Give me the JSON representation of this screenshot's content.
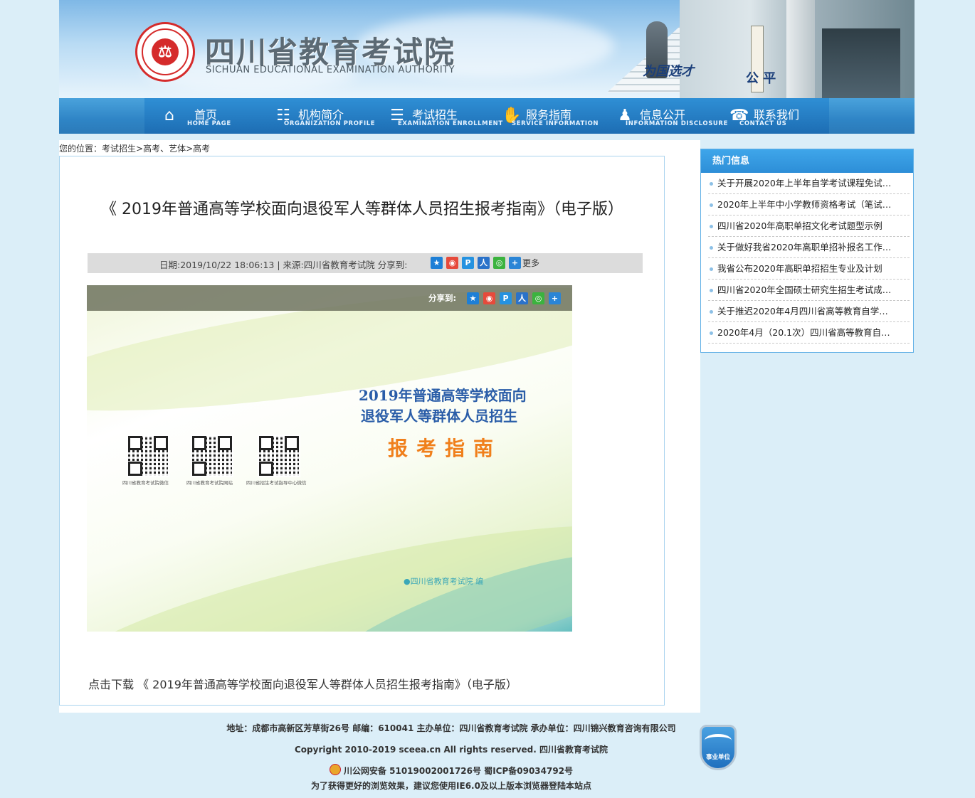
{
  "header": {
    "site_name_cn": "四川省教育考试院",
    "site_name_en": "SICHUAN EDUCATIONAL EXAMINATION AUTHORITY",
    "logo_char": "⚖",
    "slogan": "为国选才",
    "slogan2": "公  平"
  },
  "nav": [
    {
      "cn": "首页",
      "en": "HOME PAGE",
      "icon": "home-icon",
      "glyph": "⌂"
    },
    {
      "cn": "机构简介",
      "en": "ORGANIZATION PROFILE",
      "icon": "org-chart-icon",
      "glyph": "☷"
    },
    {
      "cn": "考试招生",
      "en": "EXAMINATION ENROLLMENT",
      "icon": "document-icon",
      "glyph": "☰"
    },
    {
      "cn": "服务指南",
      "en": "SERVICE INFORMATION",
      "icon": "handshake-icon",
      "glyph": "✋"
    },
    {
      "cn": "信息公开",
      "en": "INFORMATION DISCLOSURE",
      "icon": "people-icon",
      "glyph": "♟"
    },
    {
      "cn": "联系我们",
      "en": "CONTACT US",
      "icon": "contact-icon",
      "glyph": "☎"
    }
  ],
  "breadcrumb": {
    "prefix": "您的位置：",
    "item1": "考试招生",
    "sep1": ">",
    "item2": "高考、艺体",
    "sep2": ">",
    "item3": "高考"
  },
  "article": {
    "title": "《 2019年普通高等学校面向退役军人等群体人员招生报考指南》（电子版）",
    "meta": "日期:2019/10/22 18:06:13 | 来源:四川省教育考试院   分享到:",
    "share_more": "更多",
    "download_text": "点击下载 《 2019年普通高等学校面向退役军人等群体人员招生报考指南》（电子版）"
  },
  "cover": {
    "share_label": "分享到:",
    "heading_line1": "2019年普通高等学校面向",
    "heading_line2": "退役军人等群体人员招生",
    "heading_big": "报考指南",
    "qr_labels": [
      "四川省教育考试院微信",
      "四川省教育考试院网站",
      "四川省招生考试指导中心微信"
    ],
    "editor": "●四川省教育考试院   编"
  },
  "sidebar": {
    "title": "热门信息",
    "items": [
      "关于开展2020年上半年自学考试课程免试…",
      "2020年上半年中小学教师资格考试（笔试…",
      "四川省2020年高职单招文化考试题型示例",
      "关于做好我省2020年高职单招补报名工作…",
      "我省公布2020年高职单招招生专业及计划",
      "四川省2020年全国硕士研究生招生考试成…",
      "关于推迟2020年4月四川省高等教育自学…",
      "2020年4月（20.1次）四川省高等教育自…"
    ]
  },
  "footer": {
    "line1": "地址：成都市高新区芳草街26号 邮编：610041 主办单位：四川省教育考试院 承办单位：四川锦兴教育咨询有限公司",
    "line2": "Copyright 2010-2019 sceea.cn All rights reserved. 四川省教育考试院",
    "line3": "川公网安备 51019002001726号      蜀ICP备09034792号",
    "line4": "为了获得更好的浏览效果，建议您使用IE6.0及以上版本浏览器登陆本站点",
    "badge_text": "事业单位"
  }
}
